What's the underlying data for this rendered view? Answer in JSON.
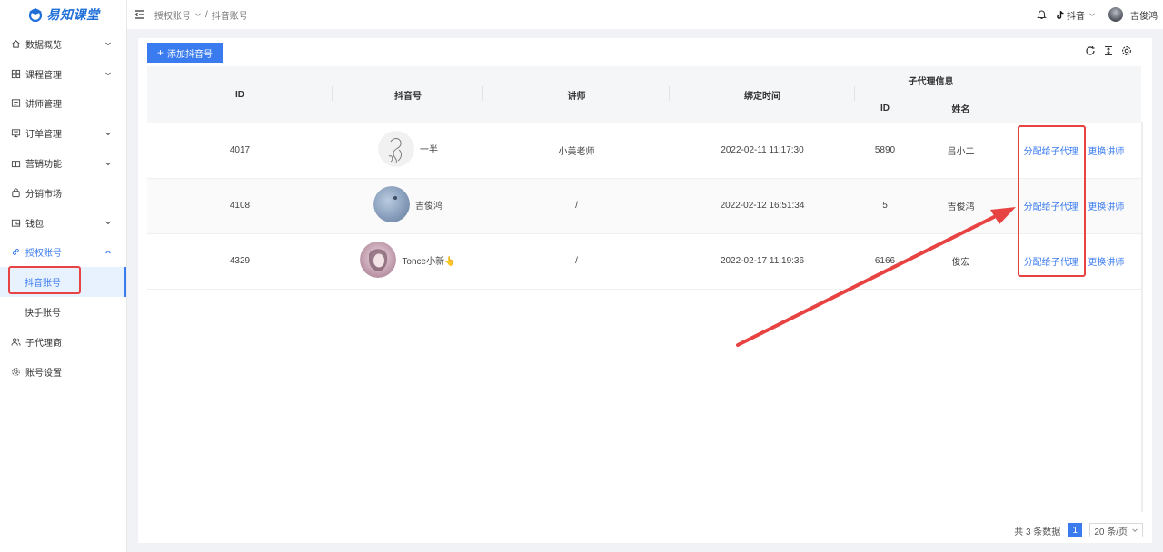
{
  "logo": {
    "text": "易知课堂"
  },
  "sidebar": {
    "items": [
      {
        "label": "数据概览",
        "icon": "home-icon",
        "has_children": true
      },
      {
        "label": "课程管理",
        "icon": "grid-icon",
        "has_children": true
      },
      {
        "label": "讲师管理",
        "icon": "id-card-icon",
        "has_children": false
      },
      {
        "label": "订单管理",
        "icon": "order-icon",
        "has_children": true
      },
      {
        "label": "营销功能",
        "icon": "gift-icon",
        "has_children": true
      },
      {
        "label": "分销市场",
        "icon": "bag-icon",
        "has_children": false
      },
      {
        "label": "钱包",
        "icon": "wallet-icon",
        "has_children": true
      },
      {
        "label": "授权账号",
        "icon": "link-icon",
        "has_children": true,
        "expanded": true
      }
    ],
    "sub_items": [
      {
        "label": "抖音账号",
        "active": true
      },
      {
        "label": "快手账号",
        "active": false
      }
    ],
    "bottom_items": [
      {
        "label": "子代理商",
        "icon": "users-icon"
      },
      {
        "label": "账号设置",
        "icon": "gear-icon"
      }
    ]
  },
  "topbar": {
    "breadcrumb": [
      "授权账号",
      "抖音账号"
    ],
    "breadcrumb_sep": "/",
    "platform": "抖音",
    "username": "吉俊鸿"
  },
  "toolbar": {
    "add_button": "添加抖音号"
  },
  "table": {
    "headers": {
      "id": "ID",
      "account": "抖音号",
      "teacher": "讲师",
      "bind_time": "绑定时间",
      "sub_agent_group": "子代理信息",
      "sub_agent_id": "ID",
      "sub_agent_name": "姓名"
    },
    "rows": [
      {
        "id": "4017",
        "account": "一半",
        "avatar": "sketch-portrait",
        "teacher": "小美老师",
        "bind_time": "2022-02-11 11:17:30",
        "agent_id": "5890",
        "agent_name": "吕小二",
        "op1": "分配给子代理",
        "op2": "更换讲师"
      },
      {
        "id": "4108",
        "account": "吉俊鸿",
        "avatar": "blue-sky",
        "teacher": "/",
        "bind_time": "2022-02-12 16:51:34",
        "agent_id": "5",
        "agent_name": "吉俊鸿",
        "op1": "分配给子代理",
        "op2": "更换讲师"
      },
      {
        "id": "4329",
        "account": "Tonce小新👆",
        "avatar": "portrait-pink",
        "teacher": "/",
        "bind_time": "2022-02-17 11:19:36",
        "agent_id": "6166",
        "agent_name": "俊宏",
        "op1": "分配给子代理",
        "op2": "更换讲师"
      }
    ]
  },
  "pagination": {
    "total_text": "共 3 条数据",
    "current_page": "1",
    "page_size": "20 条/页"
  },
  "colors": {
    "primary": "#3a7bf0",
    "annotation": "#e84343"
  }
}
